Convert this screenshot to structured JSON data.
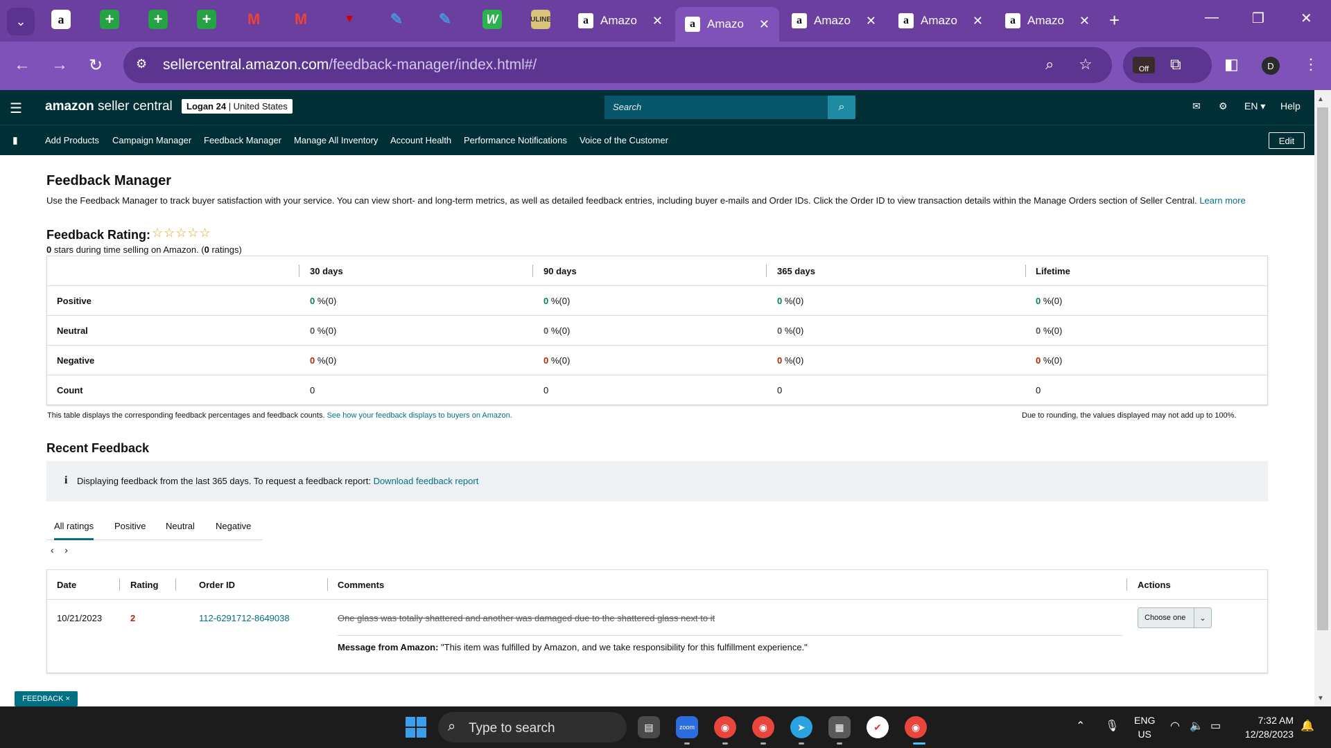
{
  "browser": {
    "tabs": [
      {
        "label": "Amazo"
      },
      {
        "label": "Amazo"
      },
      {
        "label": "Amazo"
      },
      {
        "label": "Amazo"
      },
      {
        "label": "Amazo"
      }
    ],
    "url_domain": "sellercentral.amazon.com",
    "url_path": "/feedback-manager/index.html#/",
    "ext_badge": "Off",
    "profile_initial": "D",
    "accent": "#7e52b8"
  },
  "sc_header": {
    "logo_amazon": "amazon",
    "logo_rest": " seller central",
    "account_name": "Logan 24",
    "account_region": " | United States",
    "search_placeholder": "Search",
    "lang": "EN",
    "help": "Help",
    "brand_color": "#002f36"
  },
  "sc_nav": {
    "items": [
      "Add Products",
      "Campaign Manager",
      "Feedback Manager",
      "Manage All Inventory",
      "Account Health",
      "Performance Notifications",
      "Voice of the Customer"
    ],
    "edit": "Edit"
  },
  "page": {
    "title": "Feedback Manager",
    "intro": "Use the Feedback Manager to track buyer satisfaction with your service. You can view short- and long-term metrics, as well as detailed feedback entries, including buyer e-mails and Order IDs. Click the Order ID to view transaction details within the Manage Orders section of Seller Central. ",
    "learn_more": "Learn more",
    "rating_title": "Feedback Rating:",
    "stars": "☆☆☆☆☆",
    "rating_stars_value": "0",
    "rating_sub_mid": " stars during time selling on Amazon. (",
    "rating_count": "0",
    "rating_sub_end": " ratings)"
  },
  "feedback_table": {
    "headers": [
      "30 days",
      "90 days",
      "365 days",
      "Lifetime"
    ],
    "rows": [
      {
        "label": "Positive",
        "values": [
          "0",
          "0",
          "0",
          "0"
        ],
        "suffix": " %(0)"
      },
      {
        "label": "Neutral",
        "values": [
          "0",
          "0",
          "0",
          "0"
        ],
        "suffix": " %(0)"
      },
      {
        "label": "Negative",
        "values": [
          "0",
          "0",
          "0",
          "0"
        ],
        "suffix": " %(0)"
      },
      {
        "label": "Count",
        "values": [
          "0",
          "0",
          "0",
          "0"
        ],
        "suffix": ""
      }
    ],
    "note_left": "This table displays the corresponding feedback percentages and feedback counts. ",
    "note_link": "See how your feedback displays to buyers on Amazon.",
    "note_right": "Due to rounding, the values displayed may not add up to 100%."
  },
  "recent": {
    "title": "Recent Feedback",
    "info_text": "Displaying feedback from the last 365 days. To request a feedback report: ",
    "info_link": "Download feedback report",
    "tabs": [
      "All ratings",
      "Positive",
      "Neutral",
      "Negative"
    ],
    "headers": [
      "Date",
      "Rating",
      "Order ID",
      "Comments",
      "Actions"
    ],
    "rows": [
      {
        "date": "10/21/2023",
        "rating": "2",
        "order_id": "112-6291712-8649038",
        "comment": "One glass was totally shattered and another was damaged due to the shattered glass next to it",
        "message_label": "Message from Amazon:",
        "message": " \"This item was fulfilled by Amazon, and we take responsibility for this fulfillment experience.\"",
        "action": "Choose one"
      }
    ]
  },
  "feedback_tag": "FEEDBACK ×",
  "taskbar": {
    "search_placeholder": "Type to search",
    "lang_top": "ENG",
    "lang_bottom": "US",
    "time": "7:32 AM",
    "date": "12/28/2023"
  }
}
